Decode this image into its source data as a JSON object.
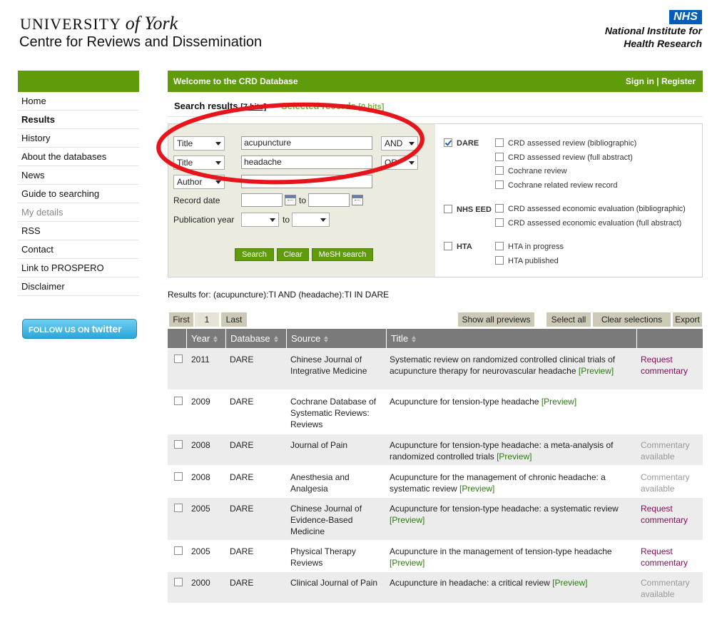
{
  "header": {
    "university": "UNIVERSITY",
    "university_of": "of York",
    "centre": "Centre for Reviews and Dissemination",
    "nhs_logo": "NHS",
    "nihr_line1": "National Institute for",
    "nihr_line2": "Health Research"
  },
  "sidebar": {
    "items": [
      {
        "label": "Home"
      },
      {
        "label": "Results"
      },
      {
        "label": "History"
      },
      {
        "label": "About the databases"
      },
      {
        "label": "News"
      },
      {
        "label": "Guide to searching"
      },
      {
        "label": "My details"
      },
      {
        "label": "RSS"
      },
      {
        "label": "Contact"
      },
      {
        "label": "Link to PROSPERO"
      },
      {
        "label": "Disclaimer"
      }
    ],
    "twitter_follow": "FOLLOW US ON",
    "twitter_brand": "twitter"
  },
  "topbar": {
    "welcome": "Welcome to the CRD Database",
    "sign_in": "Sign in",
    "separator": "|",
    "register": "Register"
  },
  "tabs": {
    "results_label": "Search results",
    "results_hits": "[7 hits]",
    "selected_label": "Selected records",
    "selected_hits": "[0 hits]"
  },
  "search": {
    "rows": [
      {
        "field": "Title",
        "value": "acupuncture",
        "operator": "AND"
      },
      {
        "field": "Title",
        "value": "headache",
        "operator": "OR"
      },
      {
        "field": "Author",
        "value": ""
      }
    ],
    "record_date_label": "Record date",
    "to_label": "to",
    "publication_year_label": "Publication year",
    "buttons": {
      "search": "Search",
      "clear": "Clear",
      "mesh": "MeSH search"
    },
    "databases": {
      "dare": {
        "label": "DARE",
        "checked": true,
        "options": [
          "CRD assessed review (bibliographic)",
          "CRD assessed review (full abstract)",
          "Cochrane review",
          "Cochrane related review record"
        ]
      },
      "nhs_eed": {
        "label": "NHS EED",
        "checked": false,
        "options": [
          "CRD assessed economic evaluation (bibliographic)",
          "CRD assessed economic evaluation (full abstract)"
        ]
      },
      "hta": {
        "label": "HTA",
        "checked": false,
        "options": [
          "HTA in progress",
          "HTA published"
        ]
      }
    }
  },
  "results_for": "Results for: (acupuncture):TI AND (headache):TI IN DARE",
  "pagination": {
    "first": "First",
    "current": "1",
    "last": "Last"
  },
  "actions": {
    "show_previews": "Show all previews",
    "select_all": "Select all",
    "clear_selections": "Clear selections",
    "export": "Export"
  },
  "table": {
    "headers": {
      "year": "Year",
      "database": "Database",
      "source": "Source",
      "title": "Title"
    },
    "preview_label": "[Preview]",
    "rows": [
      {
        "year": "2011",
        "database": "DARE",
        "source": "Chinese Journal of Integrative Medicine",
        "title": "Systematic review on randomized controlled clinical trials of acupuncture therapy for neurovascular headache",
        "commentary": "Request commentary"
      },
      {
        "year": "2009",
        "database": "DARE",
        "source": "Cochrane Database of Systematic Reviews: Reviews",
        "title": "Acupuncture for tension-type headache",
        "commentary": ""
      },
      {
        "year": "2008",
        "database": "DARE",
        "source": "Journal of Pain",
        "title": "Acupuncture for tension-type headache: a meta-analysis of randomized controlled trials",
        "commentary": "Commentary available"
      },
      {
        "year": "2008",
        "database": "DARE",
        "source": "Anesthesia and Analgesia",
        "title": "Acupuncture for the management of chronic headache: a systematic review",
        "commentary": "Commentary available"
      },
      {
        "year": "2005",
        "database": "DARE",
        "source": "Chinese Journal of Evidence-Based Medicine",
        "title": "Acupuncture for tension-type headache: a systematic review",
        "commentary": "Request commentary"
      },
      {
        "year": "2005",
        "database": "DARE",
        "source": "Physical Therapy Reviews",
        "title": "Acupuncture in the management of tension-type headache",
        "commentary": "Request commentary"
      },
      {
        "year": "2000",
        "database": "DARE",
        "source": "Clinical Journal of Pain",
        "title": "Acupuncture in headache: a critical review",
        "commentary": "Commentary available"
      }
    ]
  },
  "colors": {
    "brand_green": "#5f9b0a",
    "annotation_red": "#e8141c",
    "nhs_blue": "#005eb8"
  }
}
